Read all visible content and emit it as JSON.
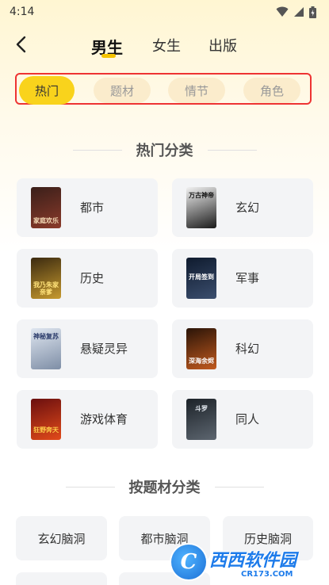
{
  "status": {
    "time": "4:14"
  },
  "nav": {
    "tabs": [
      {
        "label": "男生",
        "active": true
      },
      {
        "label": "女生",
        "active": false
      },
      {
        "label": "出版",
        "active": false
      }
    ]
  },
  "subtabs": [
    {
      "label": "热门",
      "active": true
    },
    {
      "label": "题材",
      "active": false
    },
    {
      "label": "情节",
      "active": false
    },
    {
      "label": "角色",
      "active": false
    }
  ],
  "hot": {
    "title": "热门分类",
    "categories": [
      {
        "label": "都市",
        "cover_text": "家庭欢乐",
        "cover_colors": [
          "#3a1f1a",
          "#8a3a2a"
        ]
      },
      {
        "label": "玄幻",
        "cover_text": "万古神帝",
        "cover_colors": [
          "#f2f2f2",
          "#1a1a1a"
        ]
      },
      {
        "label": "历史",
        "cover_text": "我乃朱家亲爹",
        "cover_colors": [
          "#3b2a10",
          "#c79a2e"
        ]
      },
      {
        "label": "军事",
        "cover_text": "开局签到",
        "cover_colors": [
          "#0f1b2e",
          "#3b4e6e"
        ]
      },
      {
        "label": "悬疑灵异",
        "cover_text": "神秘复苏",
        "cover_colors": [
          "#dfe6f0",
          "#7e8ea6"
        ]
      },
      {
        "label": "科幻",
        "cover_text": "深海余烬",
        "cover_colors": [
          "#2a1408",
          "#c25a1e"
        ]
      },
      {
        "label": "游戏体育",
        "cover_text": "狂野奔天",
        "cover_colors": [
          "#6a0f0f",
          "#e24a1a"
        ]
      },
      {
        "label": "同人",
        "cover_text": "斗罗",
        "cover_colors": [
          "#1c2228",
          "#5d6670"
        ]
      }
    ]
  },
  "themes": {
    "title": "按题材分类",
    "items": [
      "玄幻脑洞",
      "都市脑洞",
      "历史脑洞"
    ]
  },
  "watermark": {
    "logo": "C",
    "title": "西西软件园",
    "sub": "CR173.COM"
  }
}
